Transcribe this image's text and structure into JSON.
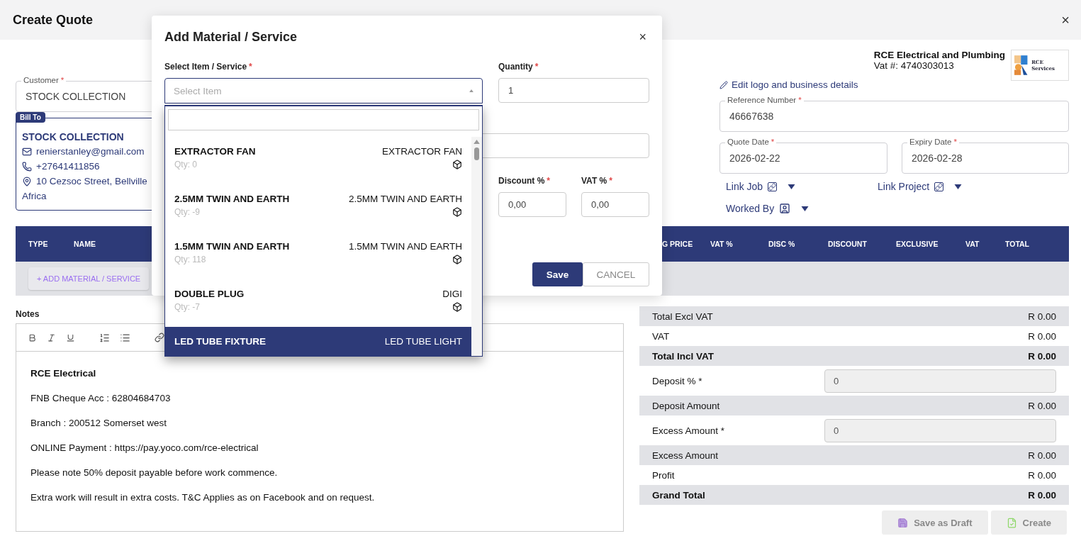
{
  "header": {
    "title": "Create Quote",
    "close": "×"
  },
  "customer": {
    "label": "Customer",
    "mark": "*",
    "value": "STOCK COLLECTION"
  },
  "bill_to": {
    "badge": "Bill To",
    "name": "STOCK COLLECTION",
    "email": "renierstanley@gmail.com",
    "phone": "+27641411856",
    "address": "10 Cezsoc Street, Bellville",
    "address_line_2": "Africa"
  },
  "business": {
    "name": "RCE Electrical and Plumbing",
    "vat": "Vat #: 4740303013",
    "logo_text": "RCE Services",
    "edit_link": "Edit logo and business details"
  },
  "fields": [
    {
      "label": "Reference Number",
      "mark": "*",
      "value": "46667638"
    }
  ],
  "dates": [
    {
      "label": "Quote Date",
      "mark": "*",
      "value": "2026-02-22"
    },
    {
      "label": "Expiry Date",
      "mark": "*",
      "value": "2026-02-28"
    }
  ],
  "links": [
    {
      "label": "Link Job",
      "kind": "link"
    },
    {
      "label": "Link Project",
      "kind": "link"
    },
    {
      "label": "Worked By",
      "kind": "person"
    }
  ],
  "table": {
    "columns": [
      "TYPE",
      "NAME",
      "G PRICE",
      "VAT %",
      "DISC %",
      "DISCOUNT",
      "EXCLUSIVE",
      "VAT",
      "TOTAL"
    ],
    "add_button": "+ ADD MATERIAL / SERVICE"
  },
  "notes": {
    "label": "Notes",
    "lines": [
      {
        "kind": "heading",
        "text": "RCE Electrical"
      },
      {
        "kind": "text",
        "text": "FNB Cheque Acc : 62804684703"
      },
      {
        "kind": "text",
        "text": "Branch : 200512 Somerset west"
      },
      {
        "kind": "text",
        "text": "ONLINE Payment : https://pay.yoco.com/rce-electrical"
      },
      {
        "kind": "text",
        "text": "Please note 50% deposit payable before work commence."
      },
      {
        "kind": "text",
        "text": "Extra work will result in extra costs. T&C Applies as on Facebook and on request."
      }
    ]
  },
  "totals": [
    {
      "kind": "amount",
      "label": "Total Excl VAT",
      "value": "R 0.00",
      "bold": false
    },
    {
      "kind": "amount",
      "label": "VAT",
      "value": "R 0.00",
      "bold": false
    },
    {
      "kind": "amount",
      "label": "Total Incl VAT",
      "value": "R 0.00",
      "bold": true
    },
    {
      "kind": "input",
      "label": "Deposit % *",
      "value": "0"
    },
    {
      "kind": "amount",
      "label": "Deposit Amount",
      "value": "R 0.00",
      "bold": false
    },
    {
      "kind": "input",
      "label": "Excess Amount *",
      "value": "0"
    },
    {
      "kind": "amount",
      "label": "Excess Amount",
      "value": "R 0.00",
      "bold": false
    },
    {
      "kind": "amount",
      "label": "Profit",
      "value": "R 0.00",
      "bold": false
    },
    {
      "kind": "amount",
      "label": "Grand Total",
      "value": "R 0.00",
      "bold": true
    }
  ],
  "actions": [
    {
      "kind": "draft",
      "label": "Save as Draft",
      "disabled": true
    },
    {
      "kind": "create",
      "label": "Create",
      "disabled": true
    }
  ],
  "modal": {
    "title": "Add Material / Service",
    "close": "×",
    "select": {
      "label": "Select Item / Service",
      "mark": "*",
      "placeholder": "Select Item"
    },
    "quantity": {
      "label": "Quantity",
      "mark": "*",
      "value": "1"
    },
    "discount": {
      "label": "Discount %",
      "mark": "*",
      "value": "0,00"
    },
    "vat": {
      "label": "VAT %",
      "mark": "*",
      "value": "0,00"
    },
    "save": "Save",
    "cancel": "CANCEL",
    "dropdown": {
      "items": [
        {
          "name": "EXTRACTOR FAN",
          "qty": "Qty: 0",
          "code": "EXTRACTOR FAN",
          "selected": false
        },
        {
          "name": "2.5MM TWIN AND EARTH",
          "qty": "Qty: -9",
          "code": "2.5MM TWIN AND EARTH",
          "selected": false
        },
        {
          "name": "1.5MM TWIN AND EARTH",
          "qty": "Qty: 118",
          "code": "1.5MM TWIN AND EARTH",
          "selected": false
        },
        {
          "name": "DOUBLE PLUG",
          "qty": "Qty: -7",
          "code": "DIGI",
          "selected": false
        },
        {
          "name": "LED TUBE FIXTURE",
          "code": "LED TUBE LIGHT",
          "selected": true
        }
      ]
    }
  }
}
